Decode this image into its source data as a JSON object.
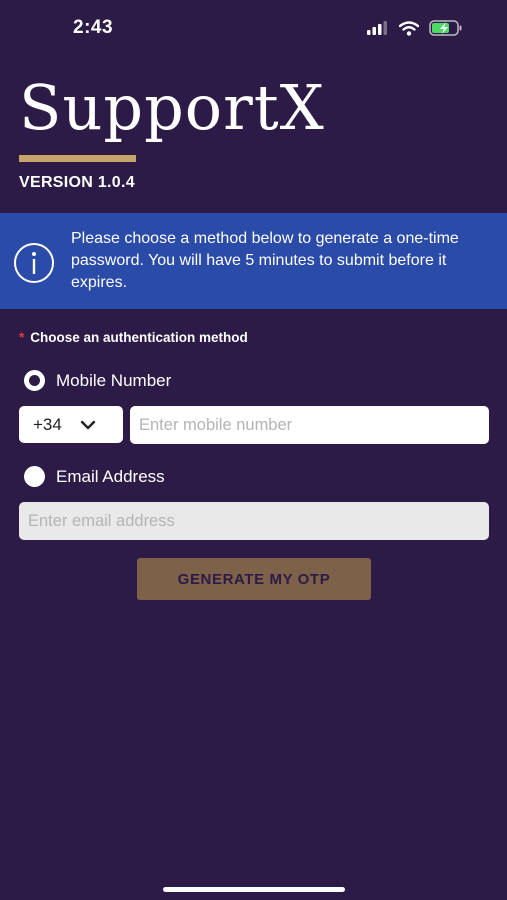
{
  "status_bar": {
    "time": "2:43"
  },
  "app": {
    "title": "SupportX",
    "version": "VERSION 1.0.4"
  },
  "info_banner": {
    "text": "Please choose a method below to generate a one-time password. You will have 5 minutes to submit before it expires."
  },
  "auth_section": {
    "required_marker": "*",
    "label": "Choose an authentication method",
    "options": [
      {
        "label": "Mobile Number",
        "selected": true
      },
      {
        "label": "Email Address",
        "selected": false
      }
    ],
    "country_code": "+34",
    "mobile_placeholder": "Enter mobile number",
    "email_placeholder": "Enter email address"
  },
  "actions": {
    "generate_label": "GENERATE MY OTP"
  },
  "colors": {
    "background": "#2d1b47",
    "accent_gold": "#c9a46a",
    "banner_blue": "#2a4ba8",
    "button_brown": "#7d6148",
    "required_red": "#e03a3a"
  },
  "icons": [
    "signal-icon",
    "wifi-icon",
    "battery-charging-icon",
    "info-circle-icon",
    "chevron-down-icon"
  ]
}
